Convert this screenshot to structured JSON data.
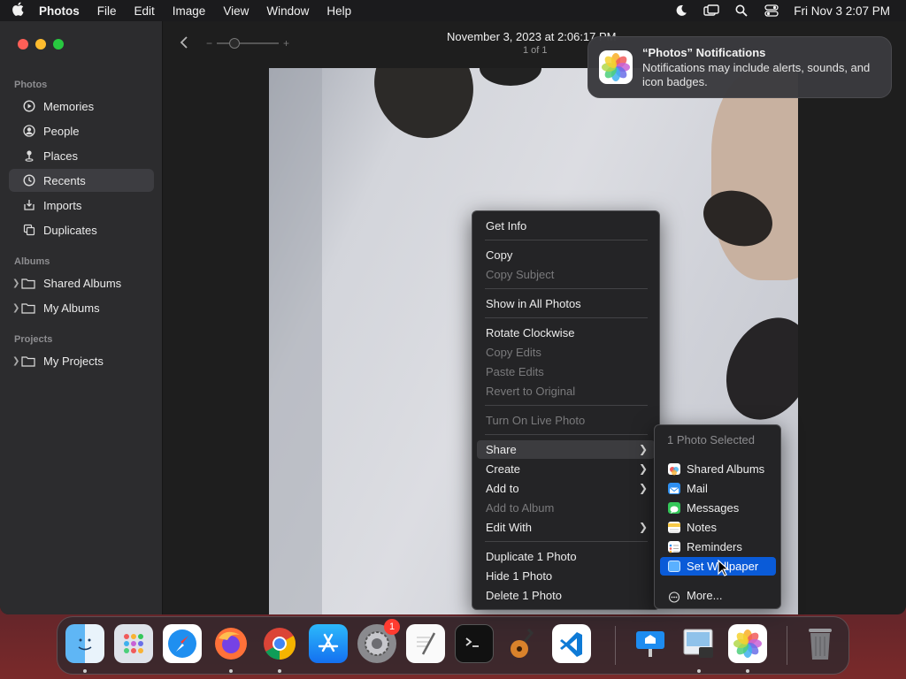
{
  "menubar": {
    "app_name": "Photos",
    "menus": [
      "File",
      "Edit",
      "Image",
      "View",
      "Window",
      "Help"
    ],
    "clock": "Fri Nov 3  2:07 PM"
  },
  "sidebar": {
    "section_photos": "Photos",
    "photos_items": [
      "Memories",
      "People",
      "Places",
      "Recents",
      "Imports",
      "Duplicates"
    ],
    "active_item": "Recents",
    "section_albums": "Albums",
    "album_items": [
      "Shared Albums",
      "My Albums"
    ],
    "section_projects": "Projects",
    "project_items": [
      "My Projects"
    ]
  },
  "toolbar": {
    "title": "November 3, 2023 at 2:06:17 PM",
    "subtitle": "1 of 1"
  },
  "notification": {
    "title": "“Photos” Notifications",
    "body": "Notifications may include alerts, sounds, and icon badges."
  },
  "context_menu": {
    "get_info": "Get Info",
    "copy": "Copy",
    "copy_subject": "Copy Subject",
    "show_in_all_photos": "Show in All Photos",
    "rotate_clockwise": "Rotate Clockwise",
    "copy_edits": "Copy Edits",
    "paste_edits": "Paste Edits",
    "revert_to_original": "Revert to Original",
    "turn_on_live_photo": "Turn On Live Photo",
    "share": "Share",
    "create": "Create",
    "add_to": "Add to",
    "add_to_album": "Add to Album",
    "edit_with": "Edit With",
    "duplicate": "Duplicate 1 Photo",
    "hide": "Hide 1 Photo",
    "delete": "Delete 1 Photo"
  },
  "share_submenu": {
    "header": "1 Photo Selected",
    "shared_albums": "Shared Albums",
    "mail": "Mail",
    "messages": "Messages",
    "notes": "Notes",
    "reminders": "Reminders",
    "set_wallpaper": "Set Wallpaper",
    "more": "More..."
  },
  "dock": {
    "settings_badge": "1",
    "apps": [
      "finder-icon",
      "launchpad-icon",
      "safari-icon",
      "firefox-icon",
      "chrome-icon",
      "app-store-icon",
      "system-settings-icon",
      "textedit-icon",
      "terminal-icon",
      "garageband-icon",
      "vscode-icon",
      "keynote-icon",
      "preview-icon",
      "photos-icon",
      "trash-icon"
    ]
  }
}
